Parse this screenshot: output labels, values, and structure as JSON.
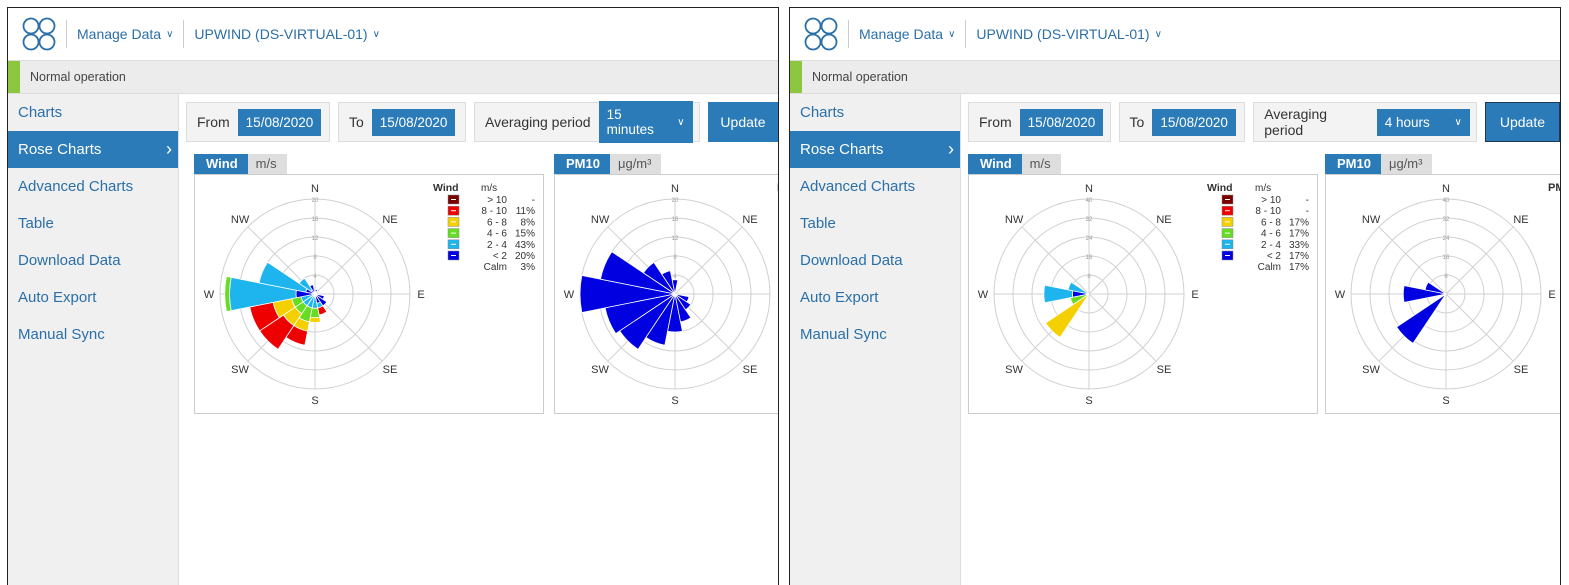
{
  "header": {
    "manage_menu": "Manage Data",
    "device_menu": "UPWIND (DS-VIRTUAL-01)",
    "status": "Normal operation"
  },
  "sidebar": {
    "items": [
      {
        "label": "Charts"
      },
      {
        "label": "Rose Charts"
      },
      {
        "label": "Advanced Charts"
      },
      {
        "label": "Table"
      },
      {
        "label": "Download Data"
      },
      {
        "label": "Auto Export"
      },
      {
        "label": "Manual Sync"
      }
    ]
  },
  "controls": {
    "from_label": "From",
    "to_label": "To",
    "averaging_label": "Averaging period",
    "update_label": "Update"
  },
  "compass": {
    "N": "N",
    "NE": "NE",
    "E": "E",
    "SE": "SE",
    "S": "S",
    "SW": "SW",
    "W": "W",
    "NW": "NW"
  },
  "legend": {
    "title": "Wind",
    "unit": "m/s",
    "labels": [
      "> 10",
      "8 - 10",
      "6 - 8",
      "4 - 6",
      "2 - 4",
      "< 2",
      "Calm"
    ],
    "colors": [
      "#7a0000",
      "#ee0000",
      "#f5d000",
      "#66dd22",
      "#1eb4ee",
      "#0000e0"
    ]
  },
  "colors": {
    "accent": "#2b7bb9",
    "status_ok": "#8dc63f"
  },
  "panels": [
    {
      "from_date": "15/08/2020",
      "to_date": "15/08/2020",
      "averaging_value": "15 minutes",
      "wind_tab": "Wind",
      "wind_unit": "m/s",
      "pm_tab": "PM10",
      "pm_unit": "μg/m³",
      "pm_cut_label": "P",
      "legend_values": [
        "-",
        "11%",
        "8%",
        "15%",
        "43%",
        "20%",
        "3%"
      ],
      "wind_ticks": [
        "4",
        "8",
        "12",
        "16",
        "20"
      ],
      "pm_ticks": [
        "4",
        "8",
        "12",
        "16",
        "20"
      ]
    },
    {
      "from_date": "15/08/2020",
      "to_date": "15/08/2020",
      "averaging_value": "4 hours",
      "wind_tab": "Wind",
      "wind_unit": "m/s",
      "pm_tab": "PM10",
      "pm_unit": "μg/m³",
      "pm_cut_label": "PM",
      "legend_values": [
        "-",
        "-",
        "17%",
        "17%",
        "33%",
        "17%",
        "17%"
      ],
      "wind_ticks": [
        "8",
        "16",
        "24",
        "32",
        "40"
      ],
      "pm_ticks": [
        "8",
        "16",
        "24",
        "32",
        "40"
      ]
    }
  ],
  "chart_data": [
    {
      "type": "rose",
      "title": "Wind",
      "unit": "m/s",
      "rmax": 20,
      "ticks": [
        4,
        8,
        12,
        16,
        20
      ],
      "bins": [
        "< 2",
        "2 - 4",
        "4 - 6",
        "6 - 8",
        "8 - 10",
        "> 10"
      ],
      "sectors": [
        {
          "dir": 247.5,
          "values": [
            0,
            3,
            2,
            4,
            5,
            0
          ]
        },
        {
          "dir": 225,
          "values": [
            0,
            3,
            2,
            3,
            6,
            0
          ]
        },
        {
          "dir": 202.5,
          "values": [
            0,
            3,
            3,
            2,
            3,
            0
          ]
        },
        {
          "dir": 180,
          "values": [
            0,
            3,
            2,
            1,
            0,
            0
          ]
        },
        {
          "dir": 157.5,
          "values": [
            2,
            1,
            0,
            0,
            1.5,
            0
          ]
        },
        {
          "dir": 135,
          "values": [
            3,
            0,
            0,
            0,
            0,
            0
          ]
        },
        {
          "dir": 112.5,
          "values": [
            2,
            0,
            0,
            0,
            0,
            0
          ]
        },
        {
          "dir": 270,
          "values": [
            4,
            14,
            1,
            0,
            0,
            0
          ]
        },
        {
          "dir": 292.5,
          "values": [
            2,
            10,
            0,
            0,
            0,
            0
          ]
        },
        {
          "dir": 315,
          "values": [
            1,
            3,
            0,
            0,
            0,
            0
          ]
        },
        {
          "dir": 337.5,
          "values": [
            2,
            0,
            0,
            0,
            0,
            0
          ]
        },
        {
          "dir": 0,
          "values": [
            1,
            0,
            0,
            0,
            0,
            0
          ]
        },
        {
          "dir": 22.5,
          "values": [
            1,
            0,
            0,
            0,
            0,
            0
          ]
        },
        {
          "dir": 67.5,
          "values": [
            0.8,
            0,
            0,
            0,
            0,
            0
          ]
        },
        {
          "dir": 45,
          "values": [
            0.6,
            0,
            0,
            0,
            0,
            0
          ]
        }
      ]
    },
    {
      "type": "rose",
      "title": "PM10",
      "unit": "μg/m³",
      "rmax": 20,
      "ticks": [
        4,
        8,
        12,
        16,
        20
      ],
      "bins": [
        "PM10"
      ],
      "sectors": [
        {
          "dir": 270,
          "values": [
            20
          ]
        },
        {
          "dir": 292.5,
          "values": [
            16
          ]
        },
        {
          "dir": 247.5,
          "values": [
            15
          ]
        },
        {
          "dir": 225,
          "values": [
            14
          ]
        },
        {
          "dir": 202.5,
          "values": [
            11
          ]
        },
        {
          "dir": 180,
          "values": [
            8
          ]
        },
        {
          "dir": 157.5,
          "values": [
            6
          ]
        },
        {
          "dir": 135,
          "values": [
            4
          ]
        },
        {
          "dir": 112.5,
          "values": [
            3
          ]
        },
        {
          "dir": 315,
          "values": [
            8
          ]
        },
        {
          "dir": 337.5,
          "values": [
            5
          ]
        },
        {
          "dir": 0,
          "values": [
            3
          ]
        }
      ]
    },
    {
      "type": "rose",
      "title": "Wind",
      "unit": "m/s",
      "rmax": 40,
      "ticks": [
        8,
        16,
        24,
        32,
        40
      ],
      "bins": [
        "< 2",
        "2 - 4",
        "4 - 6",
        "6 - 8",
        "8 - 10",
        "> 10"
      ],
      "sectors": [
        {
          "dir": 270,
          "values": [
            7,
            12,
            0,
            0,
            0,
            0
          ]
        },
        {
          "dir": 292.5,
          "values": [
            0,
            9,
            0,
            0,
            0,
            0
          ]
        },
        {
          "dir": 247.5,
          "values": [
            0,
            0,
            8,
            0,
            0,
            0
          ]
        },
        {
          "dir": 225,
          "values": [
            0,
            0,
            0,
            22,
            0,
            0
          ]
        }
      ]
    },
    {
      "type": "rose",
      "title": "PM10",
      "unit": "μg/m³",
      "rmax": 40,
      "ticks": [
        8,
        16,
        24,
        32,
        40
      ],
      "bins": [
        "PM10"
      ],
      "sectors": [
        {
          "dir": 270,
          "values": [
            18
          ]
        },
        {
          "dir": 292.5,
          "values": [
            9
          ]
        },
        {
          "dir": 225,
          "values": [
            25
          ]
        }
      ]
    }
  ]
}
